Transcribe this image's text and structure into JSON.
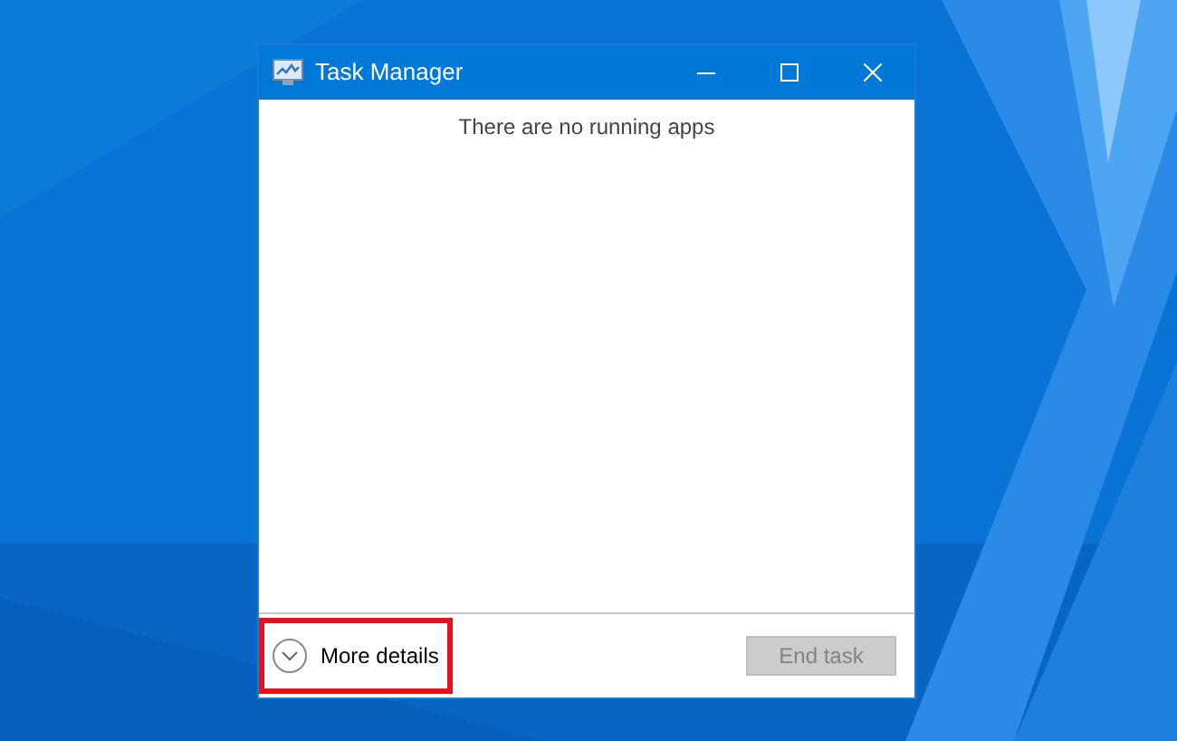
{
  "window": {
    "title": "Task Manager"
  },
  "message": "There are no running apps",
  "details_toggle": {
    "label": "More details",
    "expanded": false
  },
  "end_task_button": {
    "label": "End task",
    "disabled": true
  }
}
